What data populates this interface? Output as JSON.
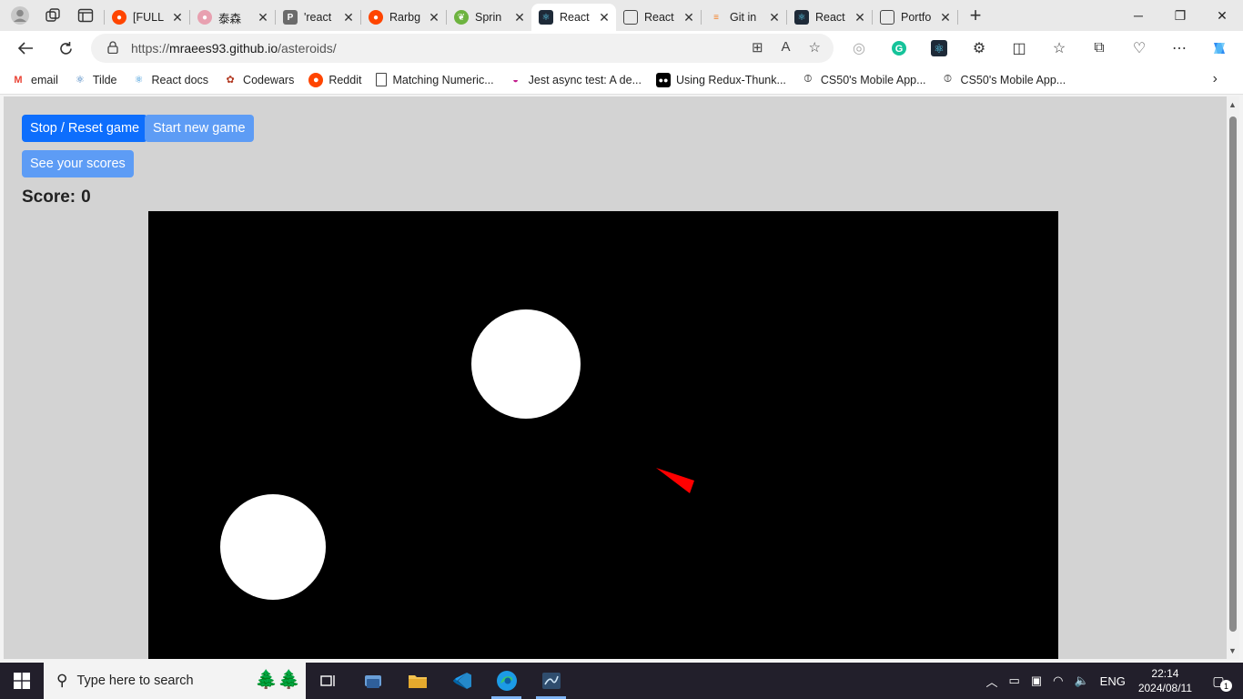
{
  "browser": {
    "tabs": [
      {
        "title": "[FULL",
        "icon": "reddit-icon",
        "color": "#ff4500",
        "active": false
      },
      {
        "title": "泰森",
        "icon": "bilibili-icon",
        "color": "#e8a0b0",
        "active": false
      },
      {
        "title": "'react",
        "icon": "p-icon",
        "color": "#555555",
        "active": false
      },
      {
        "title": "Rarbg",
        "icon": "reddit-icon",
        "color": "#ff4500",
        "active": false
      },
      {
        "title": "Sprin",
        "icon": "spring-icon",
        "color": "#6db33f",
        "active": false
      },
      {
        "title": "React",
        "icon": "react-icon",
        "color": "#1e2a38",
        "active": true
      },
      {
        "title": "React",
        "icon": "page-icon",
        "color": "#555555",
        "active": false
      },
      {
        "title": "Git in",
        "icon": "stackoverflow-icon",
        "color": "#f48024",
        "active": false
      },
      {
        "title": "React",
        "icon": "react-icon",
        "color": "#1e2a38",
        "active": false
      },
      {
        "title": "Portfo",
        "icon": "page-icon",
        "color": "#555555",
        "active": false
      }
    ],
    "address": {
      "prefix": "https://",
      "host": "mraees93.github.io",
      "path": "/asteroids/"
    },
    "bookmarks": [
      {
        "label": "email",
        "icon": "gmail-icon"
      },
      {
        "label": "Tilde",
        "icon": "react-icon"
      },
      {
        "label": "React docs",
        "icon": "react-icon"
      },
      {
        "label": "Codewars",
        "icon": "codewars-icon"
      },
      {
        "label": "Reddit",
        "icon": "reddit-icon"
      },
      {
        "label": "Matching Numeric...",
        "icon": "page-icon"
      },
      {
        "label": "Jest async test: A de...",
        "icon": "jest-icon"
      },
      {
        "label": "Using Redux-Thunk...",
        "icon": "medium-icon"
      },
      {
        "label": "CS50's Mobile App...",
        "icon": "harvard-icon"
      },
      {
        "label": "CS50's Mobile App...",
        "icon": "harvard-icon"
      }
    ]
  },
  "game": {
    "stop_button": "Stop / Reset game",
    "start_button": "Start new game",
    "scores_button": "See your scores",
    "score_label": "Score:",
    "score_value": "0",
    "colors": {
      "canvas": "#000000",
      "asteroid": "#ffffff",
      "ship": "#ff0000",
      "page": "#d3d3d3"
    }
  },
  "taskbar": {
    "search_placeholder": "Type here to search",
    "language": "ENG",
    "time": "22:14",
    "date": "2024/08/11",
    "notification_count": "1",
    "apps": [
      "task-view-icon",
      "file-manager-icon",
      "folder-icon",
      "vscode-icon",
      "edge-icon",
      "workbench-icon"
    ]
  }
}
